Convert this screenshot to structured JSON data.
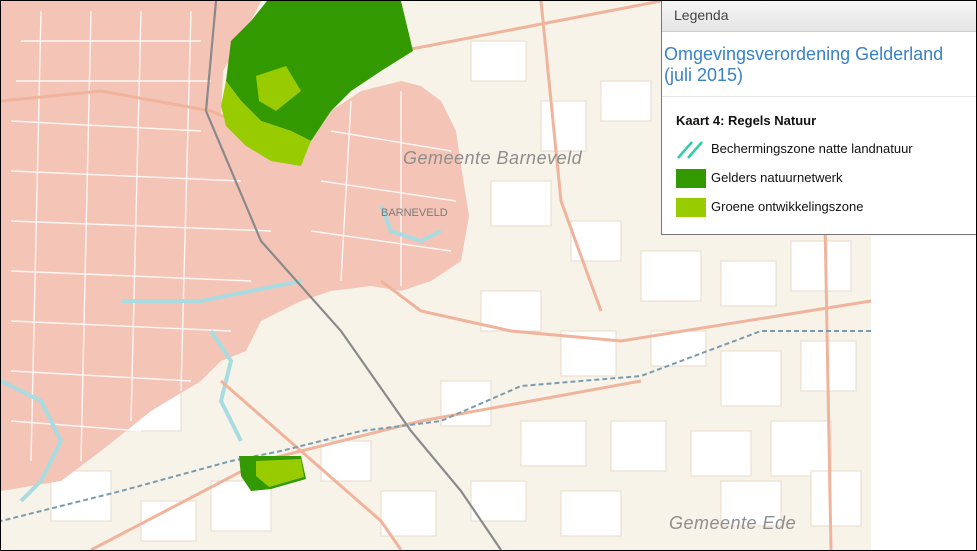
{
  "map": {
    "labels": {
      "gemeente_barneveld": "Gemeente Barneveld",
      "gemeente_ede": "Gemeente Ede",
      "barneveld": "BARNEVELD"
    },
    "colors": {
      "urban": "#f4c4b7",
      "rural": "#f7f3e8",
      "natuurnetwerk": "#339900",
      "ontwikkelingszone": "#99cc00",
      "water": "#a8dce0",
      "roads": "#f0b49c"
    }
  },
  "legend": {
    "header": "Legenda",
    "title": "Omgevingsverordening Gelderland (juli 2015)",
    "subtitle": "Kaart 4: Regels Natuur",
    "items": [
      {
        "label": "Bechermingszone natte landnatuur",
        "icon": "diagonal-lines-icon",
        "color": "#33ccaa"
      },
      {
        "label": "Gelders natuurnetwerk",
        "icon": "filled-square-icon",
        "color": "#339900"
      },
      {
        "label": "Groene ontwikkelingszone",
        "icon": "filled-square-icon",
        "color": "#99cc00"
      }
    ]
  }
}
